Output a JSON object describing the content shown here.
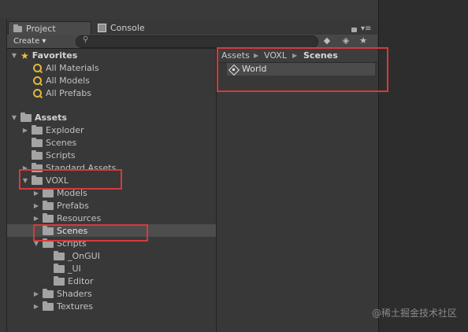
{
  "tabs": [
    {
      "label": "Project",
      "icon": "folder-icon"
    },
    {
      "label": "Console",
      "icon": "console-icon"
    }
  ],
  "toolbar": {
    "create_label": "Create ▾",
    "search_placeholder": ""
  },
  "favorites": {
    "label": "Favorites",
    "items": [
      "All Materials",
      "All Models",
      "All Prefabs"
    ]
  },
  "assets": {
    "label": "Assets",
    "items": [
      {
        "label": "Exploder"
      },
      {
        "label": "Scenes"
      },
      {
        "label": "Scripts"
      },
      {
        "label": "Standard Assets"
      },
      {
        "label": "VOXL"
      },
      {
        "label": "Models"
      },
      {
        "label": "Prefabs"
      },
      {
        "label": "Resources"
      },
      {
        "label": "Scenes"
      },
      {
        "label": "Scripts"
      },
      {
        "label": "_OnGUI"
      },
      {
        "label": "_UI"
      },
      {
        "label": "Editor"
      },
      {
        "label": "Shaders"
      },
      {
        "label": "Textures"
      }
    ]
  },
  "breadcrumb": {
    "parts": [
      "Assets",
      "VOXL",
      "Scenes"
    ]
  },
  "content": {
    "items": [
      {
        "label": "World",
        "icon": "unity-scene-icon"
      }
    ]
  },
  "watermark": "@稀土掘金技术社区",
  "colors": {
    "highlight_box": "#d63a3a",
    "selection": "#4d4d4d"
  }
}
